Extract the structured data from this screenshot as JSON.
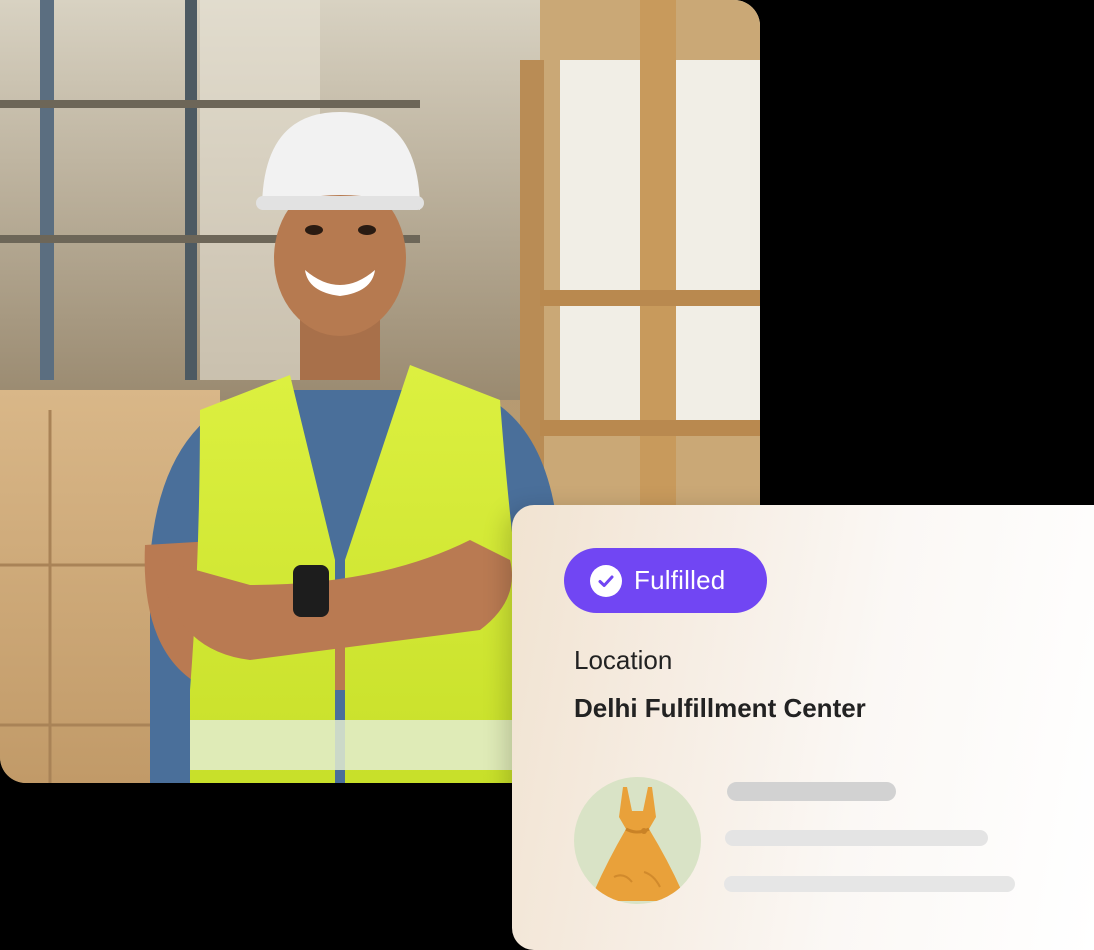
{
  "badge": {
    "label": "Fulfilled",
    "icon": "check-circle-icon",
    "color": "#7146f3"
  },
  "location": {
    "label": "Location",
    "value": "Delhi Fulfillment Center"
  },
  "product": {
    "icon": "dress-icon",
    "color": "#e9a13a"
  },
  "photo": {
    "subject": "warehouse-worker-photo"
  }
}
